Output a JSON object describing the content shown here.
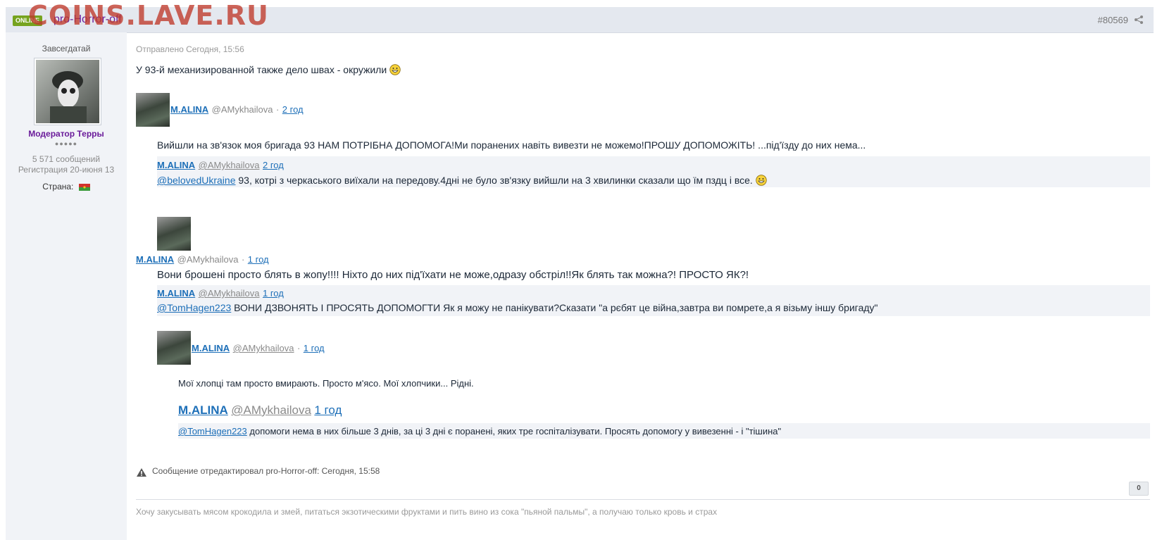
{
  "watermark": "COINS.LAVE.RU",
  "header": {
    "online_badge": "ONLINE",
    "author": "pro-Horror-off",
    "post_number": "#80569"
  },
  "user": {
    "rank": "Завсегдатай",
    "title": "Модератор Терры",
    "pips": "●●●●●",
    "posts": "5 571 сообщений",
    "registered": "Регистрация 20-июня 13",
    "country_label": "Страна:"
  },
  "post": {
    "sent": "Отправлено Сегодня, 15:56",
    "intro": "У 93-й механизированной также дело швах - окружили",
    "tweet1": {
      "name": "M.ALINA",
      "handle": "@AMykhailova",
      "sep": "·",
      "time": "2 год",
      "text": "Вийшли на зв'язок моя бригада 93 НАМ ПОТРІБНА ДОПОМОГА!Ми поранених навіть вивезти не можемо!ПРОШУ ДОПОМОЖІТЬ! ...під'їзду до них нема...",
      "quote": {
        "name": "M.ALINA",
        "handle": "@AMykhailova",
        "time": "2 год",
        "mention": "@belovedUkraine",
        "text": " 93, котрі з черкаського виїхали на передову.4дні не було зв'язку вийшли на 3 хвилинки сказали що їм пздц і все."
      }
    },
    "tweet2": {
      "name": "M.ALINA",
      "handle": "@AMykhailova",
      "sep": "·",
      "time": "1 год",
      "text": "Вони брошені просто блять в жопу!!!! Ніхто до них під'їхати не може,одразу обстріл!!Як блять так можна?! ПРОСТО ЯК?!",
      "quote": {
        "name": "M.ALINA",
        "handle": "@AMykhailova",
        "time": "1 год",
        "mention": "@TomHagen223",
        "text": " ВОНИ ДЗВОНЯТЬ І ПРОСЯТЬ ДОПОМОГТИ Як я можу не панікувати?Сказати \"а рєбят це війна,завтра ви помрете,а я візьму іншу бригаду\""
      }
    },
    "tweet3": {
      "name": "M.ALINA",
      "handle": "@AMykhailova",
      "sep": "·",
      "time": "1 год",
      "text": "Мої хлопці там просто вмирають. Просто м'ясо. Мої хлопчики... Рідні.",
      "quote": {
        "name": "M.ALINA",
        "handle": "@AMykhailova",
        "time": "1 год",
        "mention": "@TomHagen223",
        "text": " допомоги нема в них більше 3 днів, за ці 3 дні є поранені, яких тре госпіталізувати. Просять допомогу у вивезенні - і \"тішина\""
      }
    },
    "edited": "Сообщение отредактировал pro-Horror-off: Сегодня, 15:58",
    "reputation": "0",
    "signature": "Хочу закусывать мясом крокодила и змей, питаться экзотическими фруктами и пить вино из сока \"пьяной пальмы\", а получаю только кровь и страх"
  },
  "colors": {
    "accent_link": "#1d6fb8",
    "moderator_purple": "#6a1b9a",
    "online_green": "#76a31f",
    "header_bg": "#e4e8ef"
  },
  "icons": [
    "share-icon",
    "grin-emoji-icon",
    "warning-icon",
    "flag-icon"
  ]
}
